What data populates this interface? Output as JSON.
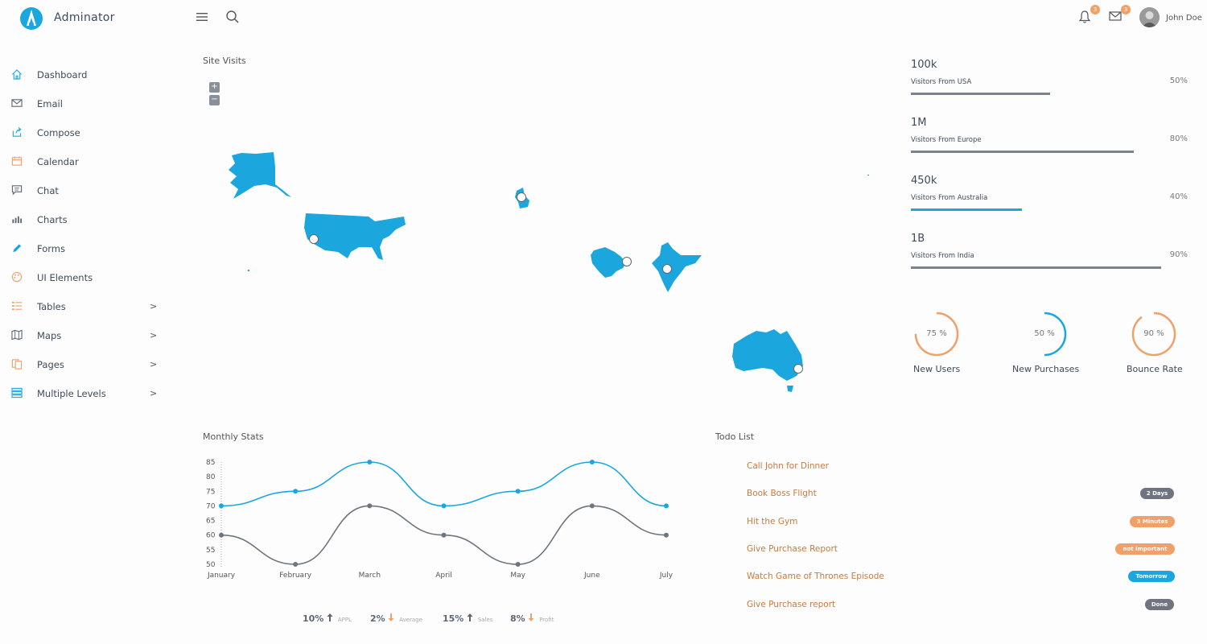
{
  "app": {
    "brand": "Adminator"
  },
  "header": {
    "notifications_count": "3",
    "messages_count": "3",
    "user_name": "John Doe"
  },
  "sidebar": {
    "items": [
      {
        "label": "Dashboard",
        "icon": "home-icon",
        "color": "#1ba7de",
        "has_children": false
      },
      {
        "label": "Email",
        "icon": "mail-icon",
        "color": "#5d6674",
        "has_children": false
      },
      {
        "label": "Compose",
        "icon": "share-icon",
        "color": "#1ba7de",
        "has_children": false
      },
      {
        "label": "Calendar",
        "icon": "calendar-icon",
        "color": "#f0a068",
        "has_children": false
      },
      {
        "label": "Chat",
        "icon": "chat-icon",
        "color": "#5d6674",
        "has_children": false
      },
      {
        "label": "Charts",
        "icon": "bar-chart-icon",
        "color": "#5d6674",
        "has_children": false
      },
      {
        "label": "Forms",
        "icon": "pencil-icon",
        "color": "#1ba7de",
        "has_children": false
      },
      {
        "label": "UI Elements",
        "icon": "palette-icon",
        "color": "#f0a068",
        "has_children": false
      },
      {
        "label": "Tables",
        "icon": "list-icon",
        "color": "#f0a068",
        "has_children": true
      },
      {
        "label": "Maps",
        "icon": "map-icon",
        "color": "#5d6674",
        "has_children": true
      },
      {
        "label": "Pages",
        "icon": "files-icon",
        "color": "#f0a068",
        "has_children": true
      },
      {
        "label": "Multiple Levels",
        "icon": "layers-icon",
        "color": "#1ba7de",
        "has_children": true
      }
    ],
    "chevron": ">"
  },
  "site_visits": {
    "title": "Site Visits",
    "zoom_in": "+",
    "zoom_out": "−",
    "map_color": "#1ba7de"
  },
  "visitor_stats": [
    {
      "value": "100k",
      "label": "Visitors From USA",
      "percent": "50%",
      "fraction": 0.5,
      "color": "#7b8290"
    },
    {
      "value": "1M",
      "label": "Visitors From Europe",
      "percent": "80%",
      "fraction": 0.8,
      "color": "#7b8290"
    },
    {
      "value": "450k",
      "label": "Visitors From Australia",
      "percent": "40%",
      "fraction": 0.4,
      "color": "#1ba7de"
    },
    {
      "value": "1B",
      "label": "Visitors From India",
      "percent": "90%",
      "fraction": 0.9,
      "color": "#7b8290"
    }
  ],
  "rings": [
    {
      "label": "New Users",
      "value": "75 %",
      "fraction": 0.75,
      "color": "#f0a068"
    },
    {
      "label": "New Purchases",
      "value": "50 %",
      "fraction": 0.5,
      "color": "#1ba7de"
    },
    {
      "label": "Bounce Rate",
      "value": "90 %",
      "fraction": 0.9,
      "color": "#f0a068"
    }
  ],
  "monthly_stats": {
    "title": "Monthly Stats",
    "summary": [
      {
        "value": "10%",
        "arrow": "up",
        "label": "APPL"
      },
      {
        "value": "2%",
        "arrow": "down",
        "label": "Average"
      },
      {
        "value": "15%",
        "arrow": "up",
        "label": "Sales"
      },
      {
        "value": "8%",
        "arrow": "down",
        "label": "Profit"
      }
    ]
  },
  "chart_data": {
    "type": "line",
    "categories": [
      "January",
      "February",
      "March",
      "April",
      "May",
      "June",
      "July"
    ],
    "series": [
      {
        "values": [
          70,
          75,
          85,
          70,
          75,
          85,
          70
        ],
        "color": "#1ba7de"
      },
      {
        "values": [
          60,
          50,
          70,
          60,
          50,
          70,
          60
        ],
        "color": "#6e7580"
      }
    ],
    "yticks": [
      85,
      80,
      75,
      70,
      65,
      60,
      55,
      50
    ],
    "ylim": [
      50,
      85
    ],
    "title": "",
    "xlabel": "",
    "ylabel": ""
  },
  "todo": {
    "title": "Todo List",
    "items": [
      {
        "text": "Call John for Dinner",
        "badge": "",
        "badge_color": ""
      },
      {
        "text": "Book Boss Flight",
        "badge": "2 Days",
        "badge_color": "#6e7580"
      },
      {
        "text": "Hit the Gym",
        "badge": "3 Minutes",
        "badge_color": "#f0a068"
      },
      {
        "text": "Give Purchase Report",
        "badge": "not important",
        "badge_color": "#f0a068"
      },
      {
        "text": "Watch Game of Thrones Episode",
        "badge": "Tomorrow",
        "badge_color": "#1ba7de"
      },
      {
        "text": "Give Purchase report",
        "badge": "Done",
        "badge_color": "#6e7580"
      }
    ]
  }
}
